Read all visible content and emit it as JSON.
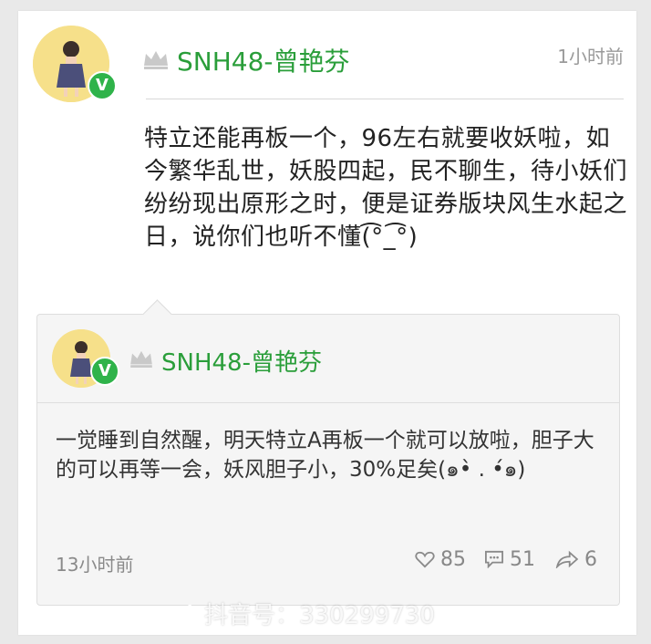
{
  "post": {
    "username": "SNH48-曾艳芬",
    "time": "1小时前",
    "text": "特立还能再板一个，96左右就要收妖啦，如今繁华乱世，妖股四起，民不聊生，待小妖们纷纷现出原形之时，便是证券版块风生水起之日，说你们也听不懂(͡°_͡°)",
    "badge": "V"
  },
  "quoted": {
    "username": "SNH48-曾艳芬",
    "badge": "V",
    "text": "一觉睡到自然醒，明天特立A再板一个就可以放啦，胆子大的可以再等一会，妖风胆子小，30%足矣(๑•̀ . •́๑)",
    "time": "13小时前",
    "likes": "85",
    "comments": "51",
    "shares": "6"
  },
  "watermark": "抖音号：330299730",
  "colors": {
    "accent": "#2a9e3a",
    "badge": "#2fb34a"
  },
  "icons": [
    "crown-icon",
    "heart-icon",
    "comment-icon",
    "share-icon",
    "tiktok-logo-icon"
  ]
}
